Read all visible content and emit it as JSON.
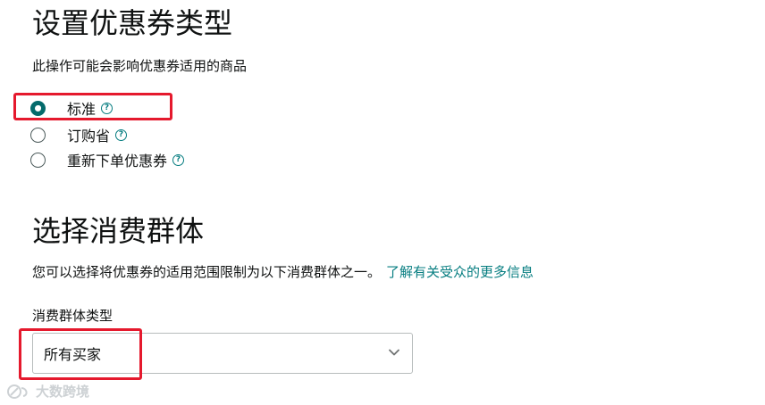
{
  "coupon_type": {
    "title": "设置优惠券类型",
    "description": "此操作可能会影响优惠券适用的商品",
    "options": [
      {
        "label": "标准",
        "selected": true
      },
      {
        "label": "订购省",
        "selected": false
      },
      {
        "label": "重新下单优惠券",
        "selected": false
      }
    ],
    "help_icon_glyph": "?"
  },
  "audience": {
    "title": "选择消费群体",
    "description": "您可以选择将优惠券的适用范围限制为以下消费群体之一。",
    "link_text": "了解有关受众的更多信息",
    "field_label": "消费群体类型",
    "select_value": "所有买家"
  },
  "watermark": {
    "text": "大数跨境"
  },
  "colors": {
    "accent": "#067d80",
    "radio_selected": "#046a6b",
    "highlight": "#e5192d",
    "text": "#0f1111"
  }
}
